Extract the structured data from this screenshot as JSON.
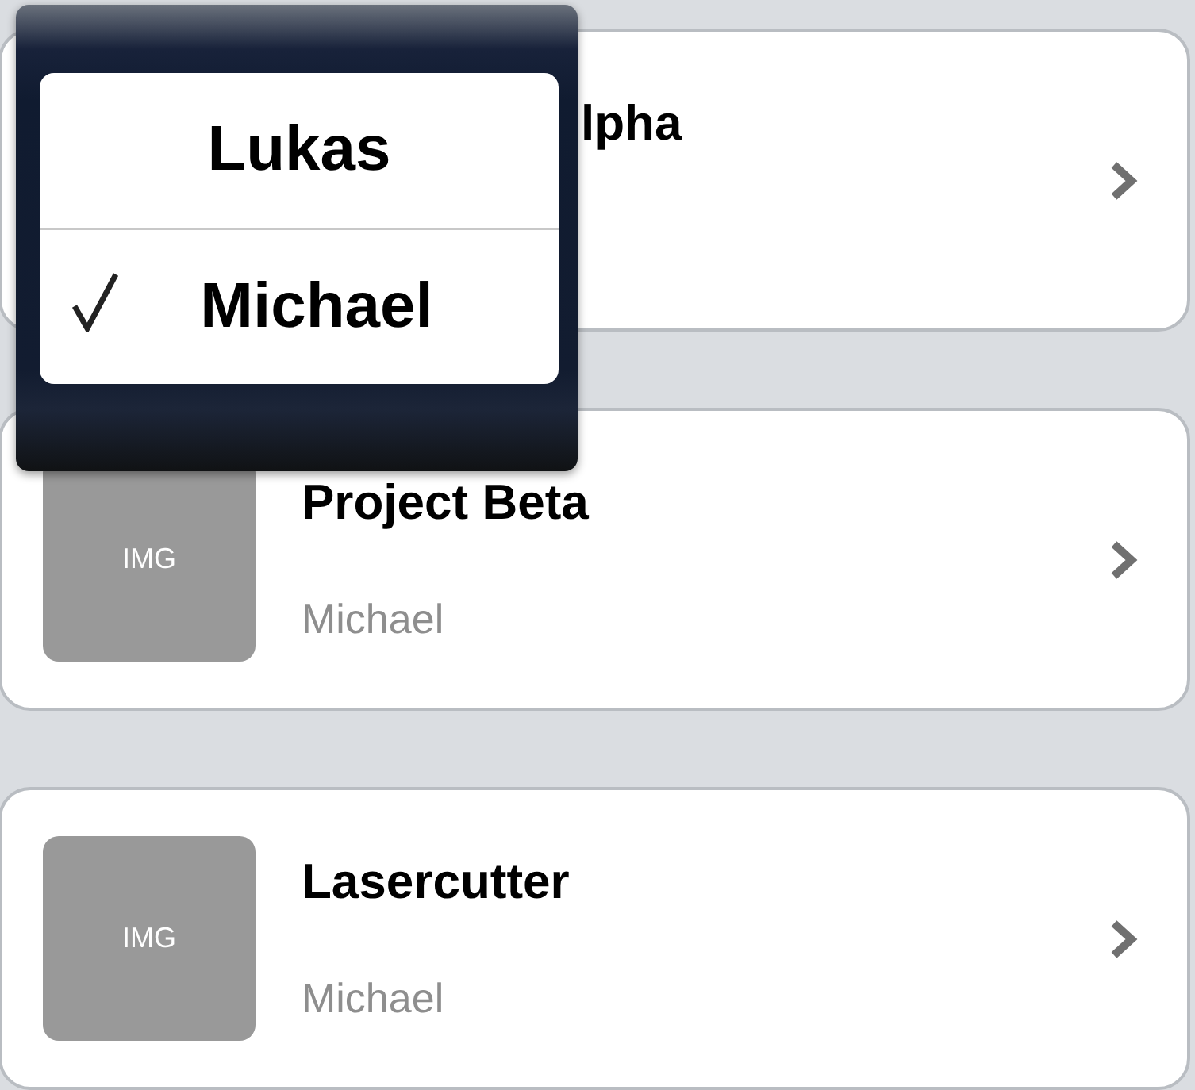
{
  "projects": [
    {
      "title": "lpha",
      "covered": true
    },
    {
      "title": "Project Beta",
      "image_label": "IMG",
      "owner": "Michael"
    },
    {
      "title": "Lasercutter",
      "image_label": "IMG",
      "owner": "Michael"
    }
  ],
  "popover": {
    "options": [
      {
        "label": "Lukas",
        "selected": false
      },
      {
        "label": "Michael",
        "selected": true
      }
    ]
  }
}
